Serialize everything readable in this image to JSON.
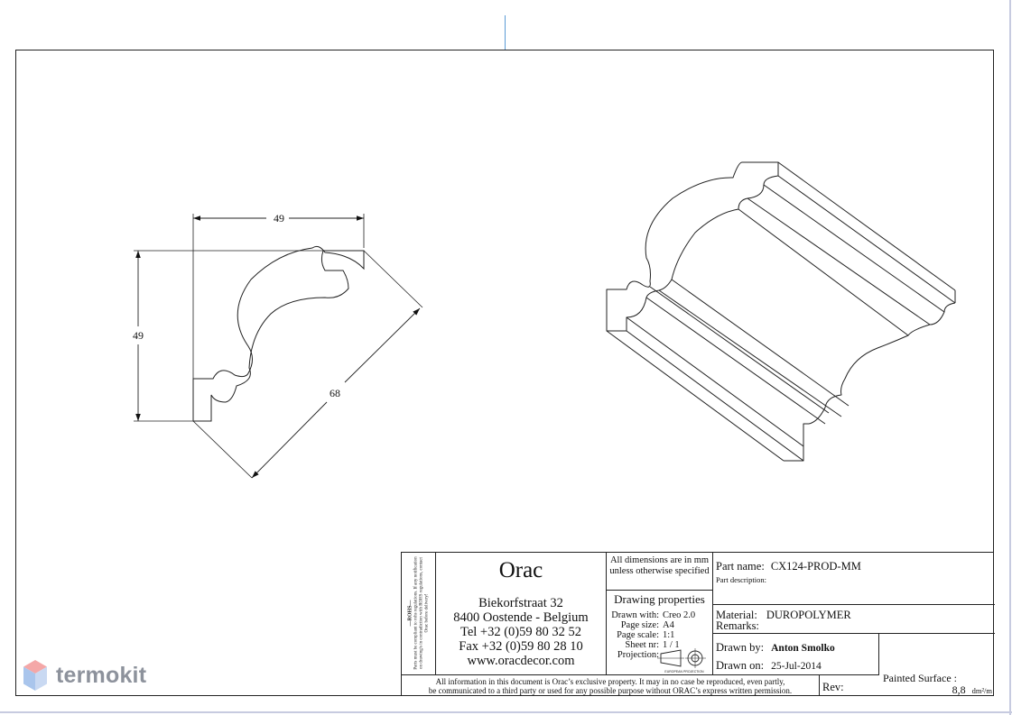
{
  "dimensions": {
    "width": "49",
    "height": "49",
    "diagonal": "68"
  },
  "side_note": {
    "rohs_label": "—ROHS—",
    "text": "Parts must be compliant to rohs regulations. If any notification on drawing/s in contradiction with ROHS regulations, contact Orac before delivery!"
  },
  "company": {
    "name": "Orac",
    "street": "Biekorfstraat 32",
    "city": "8400 Oostende - Belgium",
    "tel": "Tel   +32 (0)59 80 32 52",
    "fax": "Fax   +32 (0)59 80 28 10",
    "web": "www.oracdecor.com"
  },
  "dimension_note": "All dimensions are in mm unless otherwise specified",
  "drawing_properties": {
    "title": "Drawing properties",
    "rows": [
      {
        "label": "Drawn with:",
        "value": "Creo 2.0"
      },
      {
        "label": "Page size:",
        "value": "A4"
      },
      {
        "label": "Page scale:",
        "value": "1:1"
      },
      {
        "label": "Sheet nr:",
        "value": "1 / 1"
      },
      {
        "label": "Projection:",
        "value": ""
      }
    ],
    "projection_caption": "EUROPEAN PROJECTION"
  },
  "part": {
    "name_label": "Part name:",
    "name_value": "CX124-PROD-MM",
    "description_label": "Part description:",
    "material_label": "Material:",
    "material_value": "DUROPOLYMER",
    "remarks_label": "Remarks:"
  },
  "drawn": {
    "by_label": "Drawn by:",
    "by_value": "Anton Smolko",
    "on_label": "Drawn on:",
    "on_value": "25-Jul-2014"
  },
  "painted_surface": {
    "label": "Painted Surface :",
    "value": "8,8",
    "unit": "dm²/m"
  },
  "footer": {
    "line1": "All information in this document is Orac’s exclusive property.  It may in no case be reproduced, even partly,",
    "line2": "be communicated to a third party or used for any possible purpose without ORAC’s express written permission.",
    "rev_label": "Rev:"
  },
  "watermark": {
    "text": "termokit"
  }
}
